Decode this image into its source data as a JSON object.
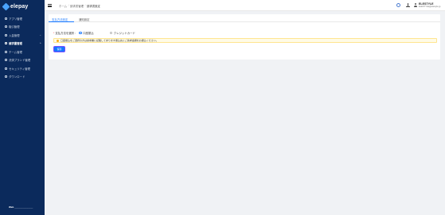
{
  "app": {
    "logo_text": "elepay"
  },
  "sidebar": {
    "items": [
      {
        "label": "アプリ管理",
        "icon": "app-icon",
        "active": false
      },
      {
        "label": "取引管理",
        "icon": "transaction-icon",
        "active": false
      },
      {
        "label": "入金管理",
        "icon": "deposit-icon",
        "active": false,
        "chevron": "⌄"
      },
      {
        "label": "請求書管理",
        "icon": "invoice-icon",
        "active": true,
        "chevron": "⌃"
      },
      {
        "label": "チーム管理",
        "icon": "team-icon",
        "active": false
      },
      {
        "label": "決済ブランド管理",
        "icon": "brand-icon",
        "active": false
      },
      {
        "label": "セキュリティ管理",
        "icon": "security-icon",
        "active": false
      },
      {
        "label": "ダウンロード",
        "icon": "download-icon",
        "active": false
      }
    ],
    "footer_brand": "Web",
    "footer_text": "________________"
  },
  "header": {
    "breadcrumb": [
      "ホーム",
      "請求書管理",
      "請求書設定"
    ],
    "user_name": "ELESTYLE",
    "user_email": "ELESTYLE@elestyle.jp"
  },
  "tabs": [
    {
      "label": "支払方法設定",
      "active": true
    },
    {
      "label": "通知設定",
      "active": false
    }
  ],
  "form": {
    "required_mark": "*",
    "payment_method_label": "支払方法を選択",
    "options": [
      {
        "label": "口座振込",
        "selected": true
      },
      {
        "label": "クレジットカード",
        "selected": false
      }
    ]
  },
  "alert": {
    "text": "口座振込をご選択の方は請求書に記載してあります振込先にご請求金額をお振込ください。"
  },
  "save_button": {
    "label": "保存"
  },
  "colors": {
    "sidebar_bg": "#0b2a5c",
    "accent": "#1677ff",
    "alert_bg": "#fffbe6"
  }
}
